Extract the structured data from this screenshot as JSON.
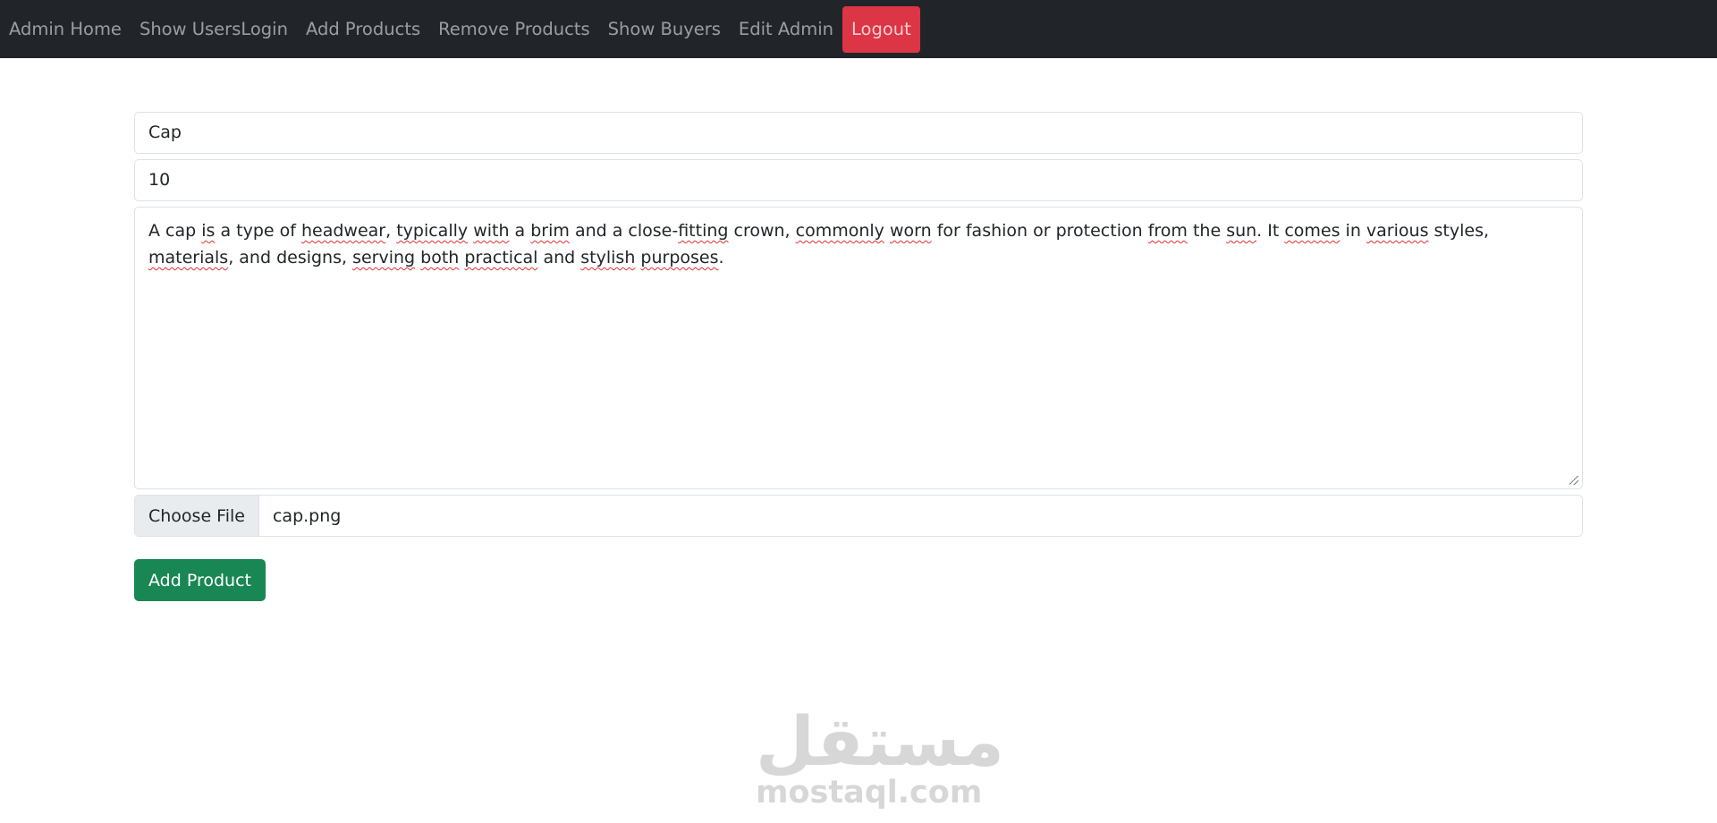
{
  "navbar": {
    "links": [
      {
        "label": "Admin Home"
      },
      {
        "label": "Show UsersLogin"
      },
      {
        "label": "Add Products"
      },
      {
        "label": "Remove Products"
      },
      {
        "label": "Show Buyers"
      },
      {
        "label": "Edit Admin"
      }
    ],
    "logout_label": "Logout"
  },
  "form": {
    "name_value": "Cap",
    "price_value": "10",
    "description": {
      "w1": "A cap ",
      "s1": "is",
      "w2": " a type of ",
      "s2": "headwear",
      "w3": ", ",
      "s3": "typically",
      "w4": " ",
      "s4": "with",
      "w5": " a ",
      "s5": "brim",
      "w6": " and a close-",
      "s6": "fitting",
      "w7": " crown, ",
      "s7": "commonly",
      "w8": " ",
      "s8": "worn",
      "w9": " for fashion or protection ",
      "s9": "from",
      "w10": " the ",
      "s10": "sun",
      "w11": ". It ",
      "s11": "comes",
      "w12": " in ",
      "s12": "various",
      "w13": " styles, ",
      "s13": "materials",
      "w14": ", and designs, ",
      "s14": "serving",
      "w15": " ",
      "s15": "both",
      "w16": " ",
      "s16": "practical",
      "w17": " and ",
      "s17": "stylish",
      "w18": " ",
      "s18": "purposes",
      "w19": "."
    },
    "file_button_label": "Choose File",
    "file_name": "cap.png",
    "submit_label": "Add Product"
  },
  "watermark": {
    "arabic": "مستقل",
    "latin": "mostaql.com"
  }
}
